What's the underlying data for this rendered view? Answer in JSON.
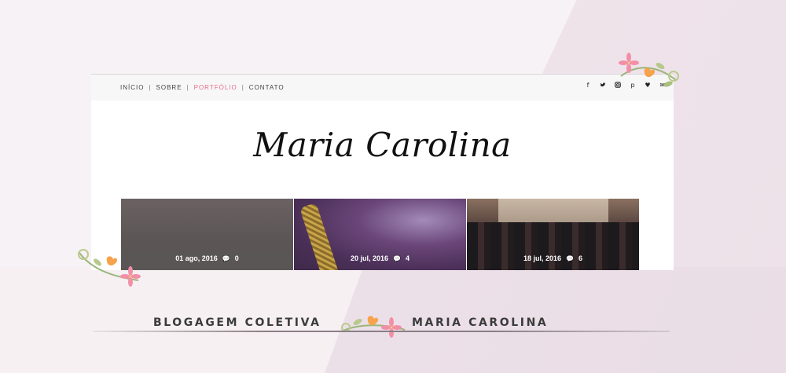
{
  "nav": {
    "items": [
      "INÍCIO",
      "SOBRE",
      "PORTFÓLIO",
      "CONTATO"
    ],
    "separator": "|",
    "active_index": 2,
    "active_color": "#e2708f"
  },
  "social_icons": [
    {
      "name": "facebook-icon",
      "glyph": "f"
    },
    {
      "name": "twitter-icon",
      "glyph": "🐦"
    },
    {
      "name": "instagram-icon",
      "glyph": "◎"
    },
    {
      "name": "pinterest-icon",
      "glyph": "p"
    },
    {
      "name": "bloglovin-icon",
      "glyph": "♥"
    },
    {
      "name": "email-icon",
      "glyph": "✉"
    }
  ],
  "blog": {
    "title": "Maria Carolina"
  },
  "posts": [
    {
      "date": "01 ago, 2016",
      "comments": "0"
    },
    {
      "date": "20 jul, 2016",
      "comments": "4"
    },
    {
      "date": "18 jul, 2016",
      "comments": "6"
    }
  ],
  "banner": {
    "left_text": "BLOGAGEM COLETIVA",
    "right_text": "MARIA CAROLINA"
  }
}
